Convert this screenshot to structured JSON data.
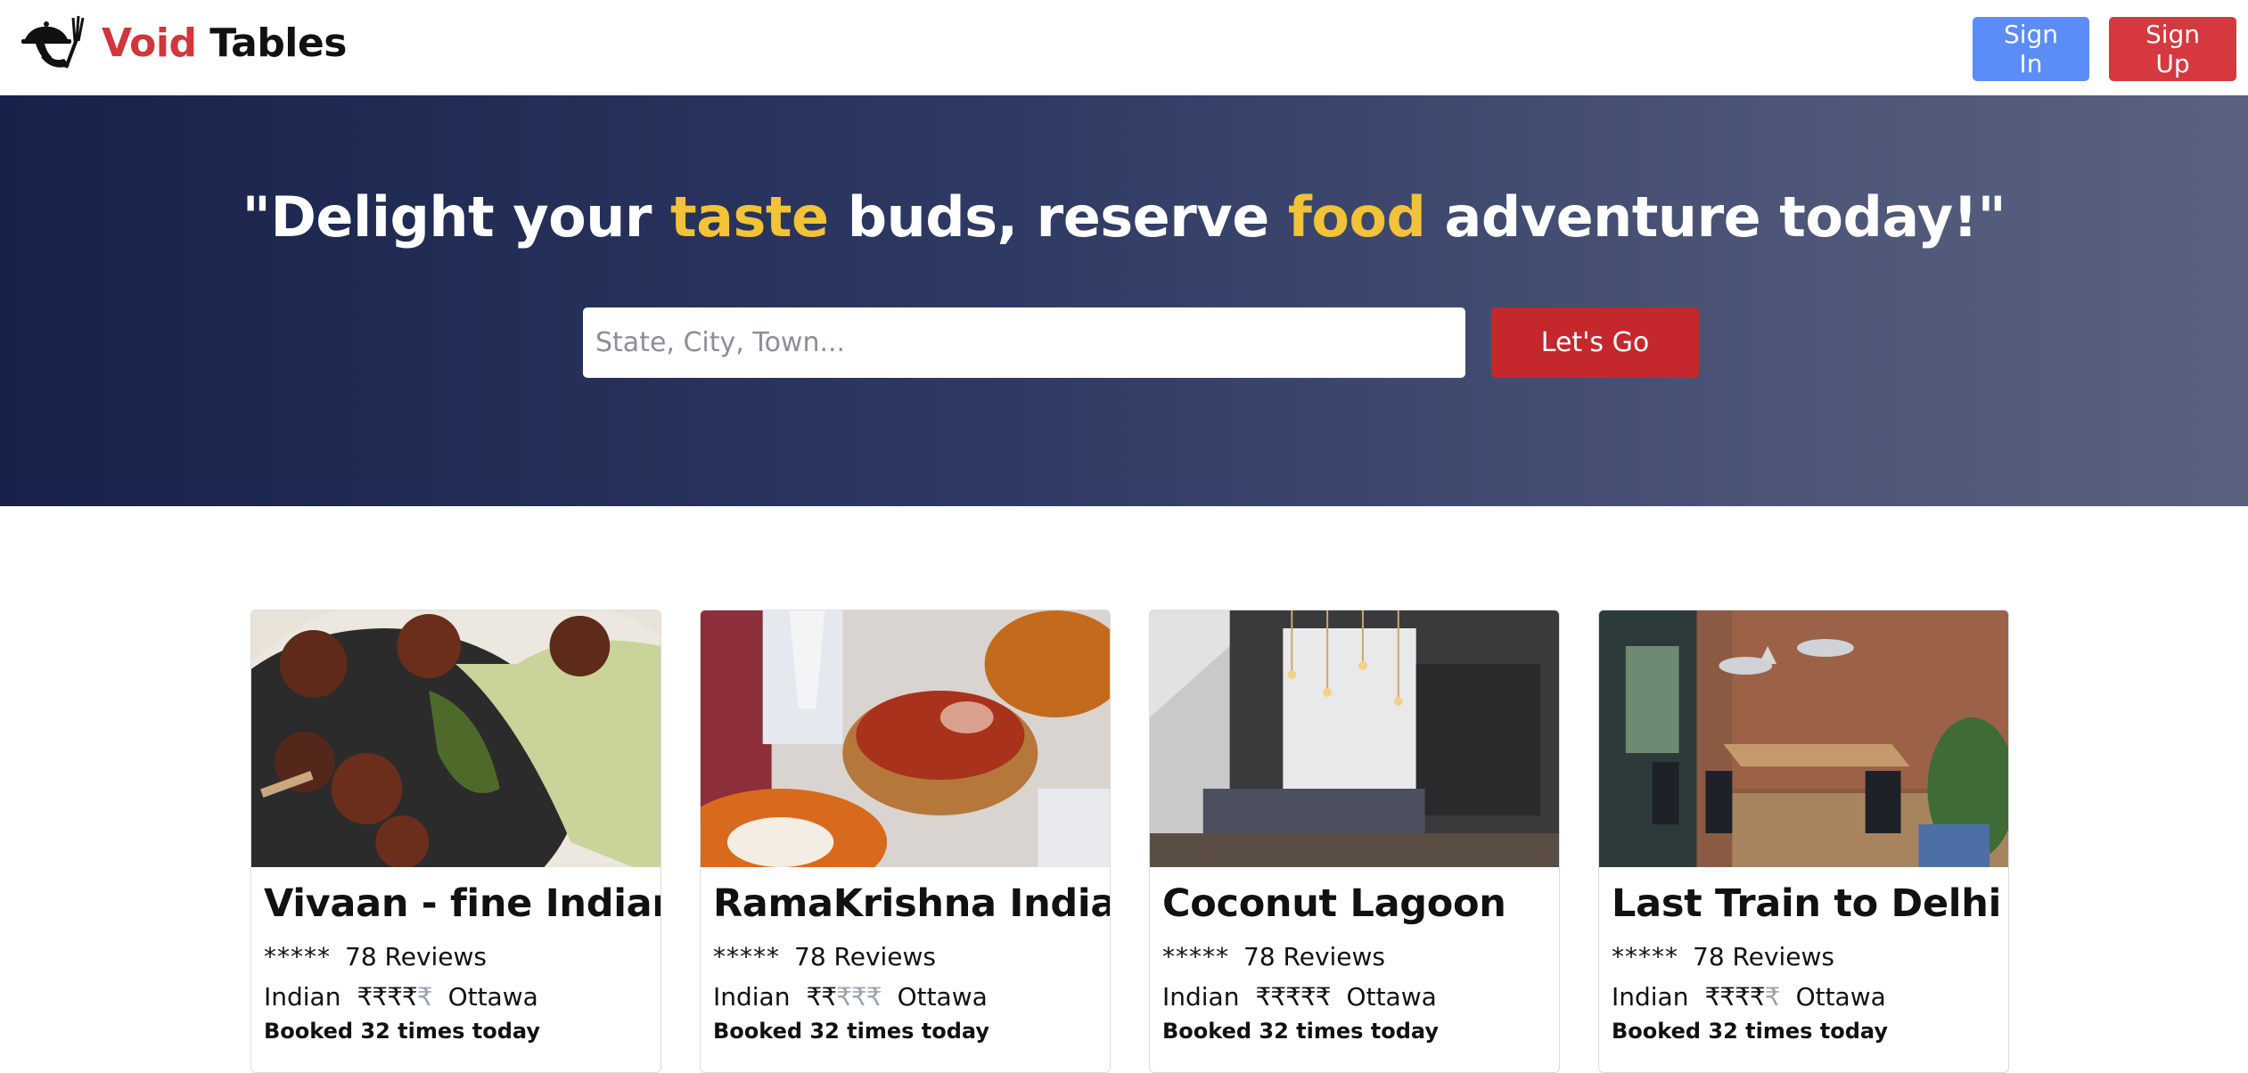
{
  "brand": {
    "name_part1": "Void",
    "name_part2": "Tables",
    "logo_icon": "waiter-tray-icon"
  },
  "nav": {
    "sign_in": "Sign In",
    "sign_up": "Sign Up"
  },
  "hero": {
    "quote_open": "\"Delight your ",
    "highlight1": "taste",
    "middle": " buds, reserve ",
    "highlight2": "food",
    "quote_close": " adventure today!\"",
    "search_placeholder": "State, City, Town...",
    "search_button": "Let's Go"
  },
  "colors": {
    "accent_red": "#d1363a",
    "highlight_yellow": "#f2c237",
    "signin_blue": "#5b8cf7",
    "hero_dark": "#172149"
  },
  "restaurants": [
    {
      "name": "Vivaan - fine Indian",
      "stars": "*****",
      "reviews": "78 Reviews",
      "cuisine": "Indian",
      "price_filled": "₹₹₹₹",
      "price_empty": "₹",
      "city": "Ottawa",
      "booked": "Booked 32 times today"
    },
    {
      "name": "RamaKrishna Indian",
      "stars": "*****",
      "reviews": "78 Reviews",
      "cuisine": "Indian",
      "price_filled": "₹₹",
      "price_empty": "₹₹₹",
      "city": "Ottawa",
      "booked": "Booked 32 times today"
    },
    {
      "name": "Coconut Lagoon",
      "stars": "*****",
      "reviews": "78 Reviews",
      "cuisine": "Indian",
      "price_filled": "₹₹₹₹₹",
      "price_empty": "",
      "city": "Ottawa",
      "booked": "Booked 32 times today"
    },
    {
      "name": "Last Train to Delhi",
      "stars": "*****",
      "reviews": "78 Reviews",
      "cuisine": "Indian",
      "price_filled": "₹₹₹₹",
      "price_empty": "₹",
      "city": "Ottawa",
      "booked": "Booked 32 times today"
    }
  ]
}
